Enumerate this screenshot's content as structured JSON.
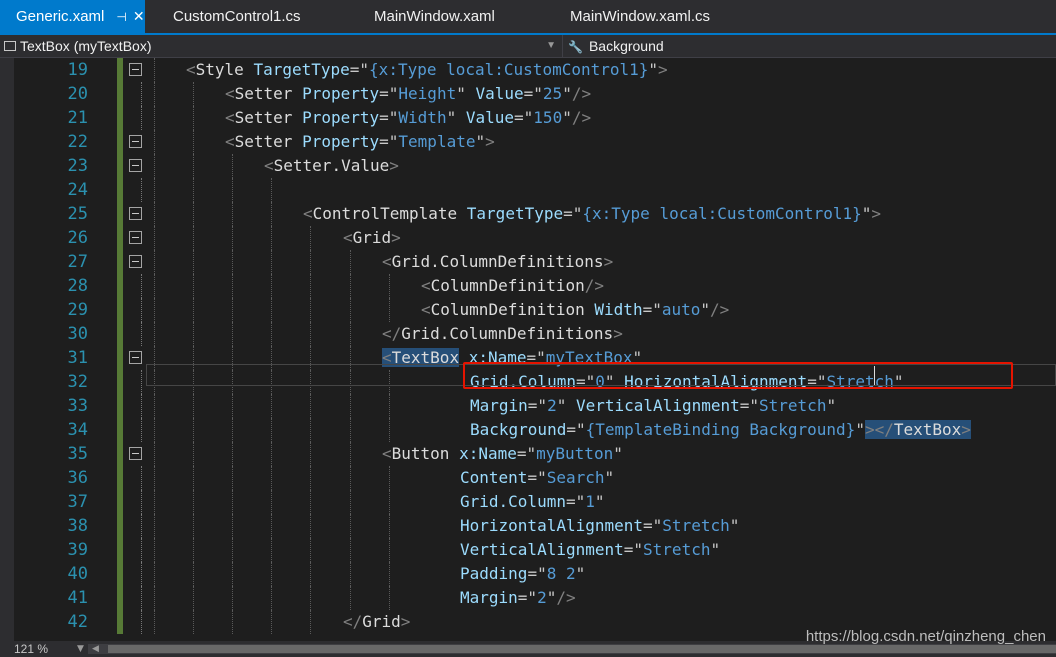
{
  "tabs": [
    {
      "label": "Generic.xaml",
      "active": true,
      "pin_icon": "pin-icon",
      "close_icon": "close-icon"
    },
    {
      "label": "CustomControl1.cs",
      "active": false
    },
    {
      "label": "MainWindow.xaml",
      "active": false
    },
    {
      "label": "MainWindow.xaml.cs",
      "active": false
    }
  ],
  "navbar": {
    "element_dropdown": "TextBox (myTextBox)",
    "property_dropdown": "Background"
  },
  "editor": {
    "line_numbers": [
      "19",
      "20",
      "21",
      "22",
      "23",
      "24",
      "25",
      "26",
      "27",
      "28",
      "29",
      "30",
      "31",
      "32",
      "33",
      "34",
      "35",
      "36",
      "37",
      "38",
      "39",
      "40",
      "41",
      "42"
    ],
    "colors": {
      "tag_bracket": "#808080",
      "element": "#dcdcdc",
      "attribute": "#9cdcfe",
      "value": "#569cd6",
      "selection": "#264f78",
      "highlight_box": "#e51400",
      "line_number": "#2b91af"
    },
    "lines": {
      "l19": {
        "style": "Style",
        "targettype_attr": "TargetType",
        "targettype_val": "{x:Type local:CustomControl1}"
      },
      "l20": {
        "setter": "Setter",
        "prop_attr": "Property",
        "prop_val": "Height",
        "value_attr": "Value",
        "value_val": "25"
      },
      "l21": {
        "setter": "Setter",
        "prop_attr": "Property",
        "prop_val": "Width",
        "value_attr": "Value",
        "value_val": "150"
      },
      "l22": {
        "setter": "Setter",
        "prop_attr": "Property",
        "prop_val": "Template"
      },
      "l23": {
        "elem": "Setter.Value"
      },
      "l25": {
        "elem": "ControlTemplate",
        "targettype_attr": "TargetType",
        "targettype_val": "{x:Type local:CustomControl1}"
      },
      "l26": {
        "elem": "Grid"
      },
      "l27": {
        "elem": "Grid.ColumnDefinitions"
      },
      "l28": {
        "elem": "ColumnDefinition"
      },
      "l29": {
        "elem": "ColumnDefinition",
        "width_attr": "Width",
        "width_val": "auto"
      },
      "l30": {
        "elem": "Grid.ColumnDefinitions"
      },
      "l31": {
        "elem": "TextBox",
        "name_attr": "x:Name",
        "name_val": "myTextBox"
      },
      "l32": {
        "col_attr": "Grid.Column",
        "col_val": "0",
        "ha_attr": "HorizontalAlignment",
        "ha_val": "Stretch"
      },
      "l33": {
        "margin_attr": "Margin",
        "margin_val": "2",
        "va_attr": "VerticalAlignment",
        "va_val": "Stretch"
      },
      "l34": {
        "bg_attr": "Background",
        "bg_val": "{TemplateBinding Background}",
        "close_elem": "TextBox"
      },
      "l35": {
        "elem": "Button",
        "name_attr": "x:Name",
        "name_val": "myButton"
      },
      "l36": {
        "attr": "Content",
        "val": "Search"
      },
      "l37": {
        "attr": "Grid.Column",
        "val": "1"
      },
      "l38": {
        "attr": "HorizontalAlignment",
        "val": "Stretch"
      },
      "l39": {
        "attr": "VerticalAlignment",
        "val": "Stretch"
      },
      "l40": {
        "attr": "Padding",
        "val": "8 2"
      },
      "l41": {
        "attr": "Margin",
        "val": "2"
      },
      "l42": {
        "elem": "Grid"
      }
    }
  },
  "status": {
    "zoom": "121 %"
  },
  "watermark": "https://blog.csdn.net/qinzheng_chen"
}
